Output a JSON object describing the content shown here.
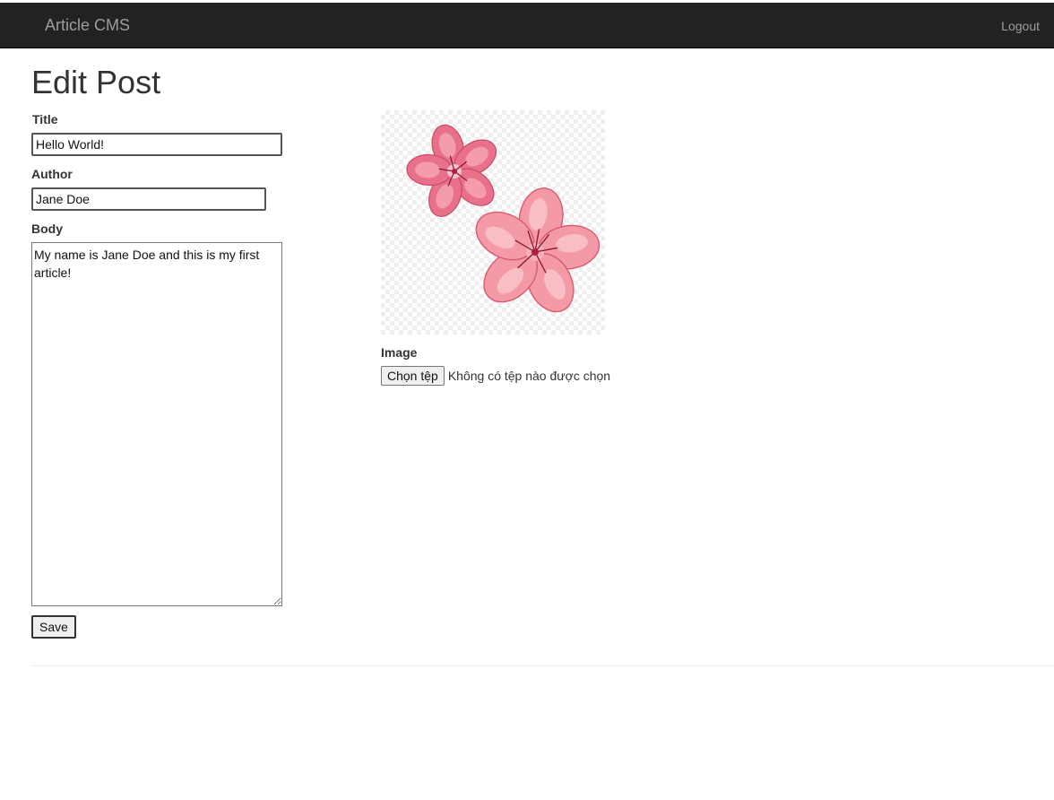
{
  "navbar": {
    "brand": "Article CMS",
    "logout": "Logout"
  },
  "page": {
    "title": "Edit Post"
  },
  "form": {
    "title_label": "Title",
    "title_value": "Hello World!",
    "author_label": "Author",
    "author_value": "Jane Doe",
    "body_label": "Body",
    "body_value": "My name is Jane Doe and this is my first article!",
    "save_label": "Save"
  },
  "image": {
    "label": "Image",
    "choose_file_label": "Chọn tệp",
    "no_file_text": "Không có tệp nào được chọn",
    "preview_icon": "cherry-blossom-flowers"
  },
  "colors": {
    "navbar_bg": "#222222",
    "navbar_text": "#9d9d9d",
    "flower_pink": "#f4a0a8",
    "flower_dark": "#e0607a"
  }
}
